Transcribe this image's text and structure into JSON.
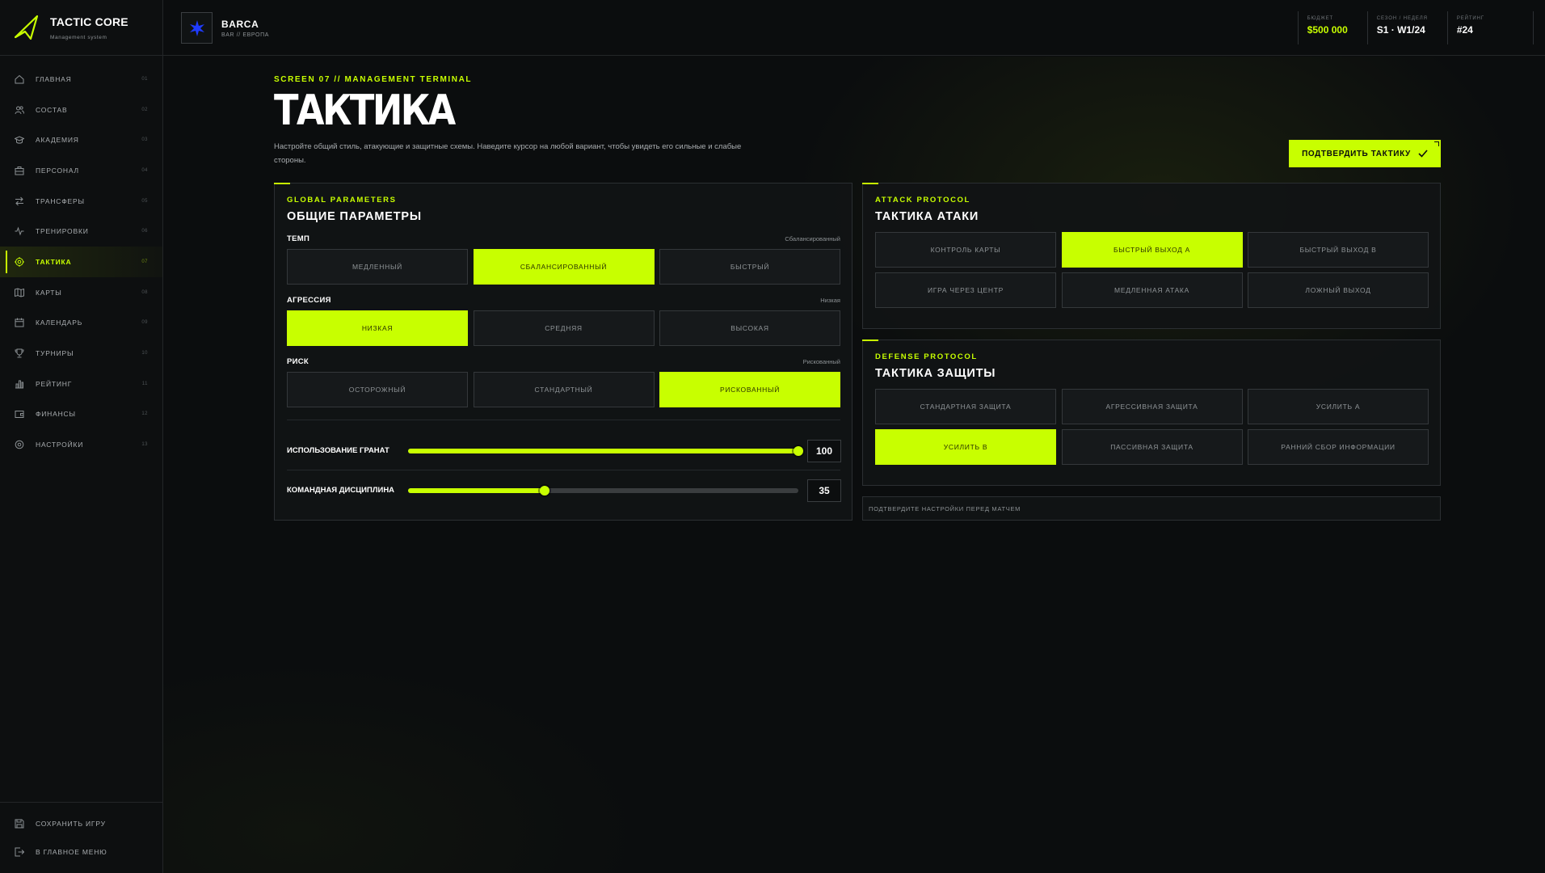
{
  "brand": {
    "title": "TACTIC CORE",
    "subtitle": "Management system"
  },
  "team": {
    "name": "BARCA",
    "sub": "BAR // ЕВРОПА"
  },
  "stats": [
    {
      "label": "БЮДЖЕТ",
      "value": "$500 000"
    },
    {
      "label": "СЕЗОН / НЕДЕЛЯ",
      "value": "S1 · W1/24"
    },
    {
      "label": "РЕЙТИНГ",
      "value": "#24"
    }
  ],
  "nav": [
    {
      "label": "ГЛАВНАЯ",
      "num": "01",
      "icon": "home-icon"
    },
    {
      "label": "СОСТАВ",
      "num": "02",
      "icon": "users-icon"
    },
    {
      "label": "АКАДЕМИЯ",
      "num": "03",
      "icon": "graduation-cap-icon"
    },
    {
      "label": "ПЕРСОНАЛ",
      "num": "04",
      "icon": "briefcase-icon"
    },
    {
      "label": "ТРАНСФЕРЫ",
      "num": "05",
      "icon": "transfer-arrows-icon"
    },
    {
      "label": "ТРЕНИРОВКИ",
      "num": "06",
      "icon": "activity-icon"
    },
    {
      "label": "ТАКТИКА",
      "num": "07",
      "icon": "target-icon",
      "active": true
    },
    {
      "label": "КАРТЫ",
      "num": "08",
      "icon": "map-icon"
    },
    {
      "label": "КАЛЕНДАРЬ",
      "num": "09",
      "icon": "calendar-icon"
    },
    {
      "label": "ТУРНИРЫ",
      "num": "10",
      "icon": "trophy-icon"
    },
    {
      "label": "РЕЙТИНГ",
      "num": "11",
      "icon": "bar-chart-icon"
    },
    {
      "label": "ФИНАНСЫ",
      "num": "12",
      "icon": "wallet-icon"
    },
    {
      "label": "НАСТРОЙКИ",
      "num": "13",
      "icon": "settings-icon"
    }
  ],
  "bottom_nav": [
    {
      "label": "СОХРАНИТЬ ИГРУ",
      "icon": "save-icon"
    },
    {
      "label": "В ГЛАВНОЕ МЕНЮ",
      "icon": "logout-icon"
    }
  ],
  "page": {
    "eyebrow": "SCREEN 07 // MANAGEMENT TERMINAL",
    "title": "ТАКТИКА",
    "desc": "Настройте общий стиль, атакующие и защитные схемы. Наведите курсор на любой вариант, чтобы увидеть его сильные и слабые стороны.",
    "confirm_label": "ПОДТВЕРДИТЬ ТАКТИКУ"
  },
  "general": {
    "eyebrow": "GLOBAL PARAMETERS",
    "title": "ОБЩИЕ ПАРАМЕТРЫ",
    "groups": [
      {
        "label": "ТЕМП",
        "value": "Сбалансированный",
        "options": [
          "МЕДЛЕННЫЙ",
          "СБАЛАНСИРОВАННЫЙ",
          "БЫСТРЫЙ"
        ],
        "selected": 1
      },
      {
        "label": "АГРЕССИЯ",
        "value": "Низкая",
        "options": [
          "НИЗКАЯ",
          "СРЕДНЯЯ",
          "ВЫСОКАЯ"
        ],
        "selected": 0
      },
      {
        "label": "РИСК",
        "value": "Рискованный",
        "options": [
          "ОСТОРОЖНЫЙ",
          "СТАНДАРТНЫЙ",
          "РИСКОВАННЫЙ"
        ],
        "selected": 2
      }
    ],
    "sliders": [
      {
        "label": "ИСПОЛЬЗОВАНИЕ ГРАНАТ",
        "value": "100",
        "fraction": 1.0
      },
      {
        "label": "КОМАНДНАЯ ДИСЦИПЛИНА",
        "value": "35",
        "fraction": 0.35
      }
    ]
  },
  "attack": {
    "eyebrow": "ATTACK PROTOCOL",
    "title": "ТАКТИКА АТАКИ",
    "options": [
      "КОНТРОЛЬ КАРТЫ",
      "БЫСТРЫЙ ВЫХОД A",
      "БЫСТРЫЙ ВЫХОД B",
      "ИГРА ЧЕРЕЗ ЦЕНТР",
      "МЕДЛЕННАЯ АТАКА",
      "ЛОЖНЫЙ ВЫХОД"
    ],
    "selected": 1
  },
  "defense": {
    "eyebrow": "DEFENSE PROTOCOL",
    "title": "ТАКТИКА ЗАЩИТЫ",
    "options": [
      "СТАНДАРТНАЯ ЗАЩИТА",
      "АГРЕССИВНАЯ ЗАЩИТА",
      "УСИЛИТЬ A",
      "УСИЛИТЬ B",
      "ПАССИВНАЯ ЗАЩИТА",
      "РАННИЙ СБОР ИНФОРМАЦИИ"
    ],
    "selected": 3
  },
  "footer_note": "ПОДТВЕРДИТЕ НАСТРОЙКИ ПЕРЕД МАТЧЕМ",
  "colors": {
    "accent": "#c8ff00",
    "background": "#0b0d0e",
    "panel": "#111315",
    "team_badge": "#1f3bff"
  }
}
